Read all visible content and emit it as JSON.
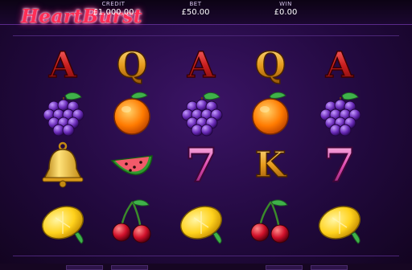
{
  "game": {
    "title": "HeartBurst"
  },
  "header": {
    "credit_label": "CREDIT",
    "credit_value": "£1,000.00",
    "bet_label": "BET",
    "bet_value": "£50.00",
    "win_label": "WIN",
    "win_value": "£0.00"
  },
  "reels": [
    [
      "A",
      "grapes",
      "bell",
      "lemon"
    ],
    [
      "Q",
      "orange",
      "watermelon",
      "cherries"
    ],
    [
      "A",
      "grapes",
      "7",
      "lemon"
    ],
    [
      "Q",
      "orange",
      "K",
      "cherries"
    ],
    [
      "A",
      "grapes",
      "7",
      "lemon"
    ]
  ],
  "colors": {
    "accent": "#ff2d55",
    "background": "#22093f"
  }
}
